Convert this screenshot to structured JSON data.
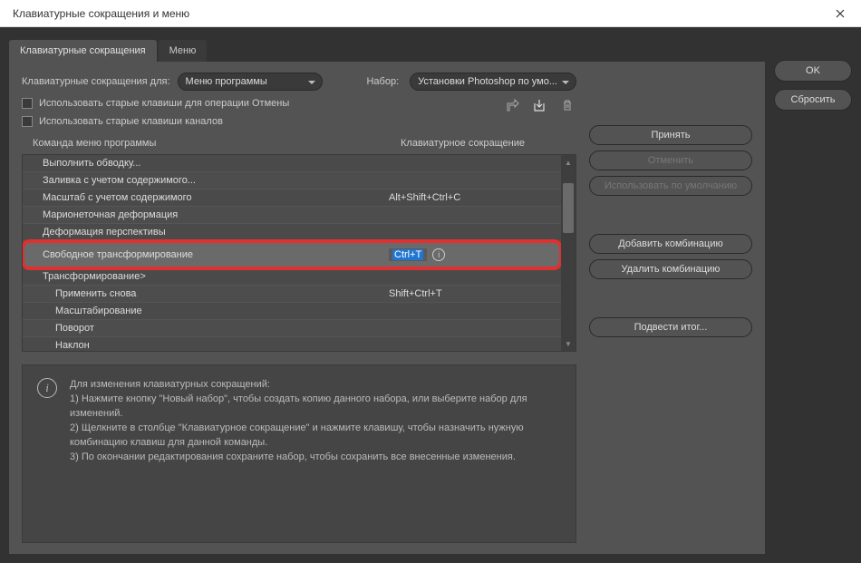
{
  "window": {
    "title": "Клавиатурные сокращения и меню"
  },
  "tabs": [
    {
      "label": "Клавиатурные сокращения",
      "active": true
    },
    {
      "label": "Меню",
      "active": false
    }
  ],
  "shortcutsFor": {
    "label": "Клавиатурные сокращения для:",
    "value": "Меню программы"
  },
  "set": {
    "label": "Набор:",
    "value": "Установки Photoshop по умо..."
  },
  "checkboxes": {
    "legacyUndo": "Использовать старые клавиши для операции Отмены",
    "legacyChannel": "Использовать старые клавиши каналов"
  },
  "columns": {
    "cmd": "Команда меню программы",
    "shortcut": "Клавиатурное сокращение"
  },
  "rows": [
    {
      "cmd": "Выполнить обводку...",
      "shortcut": "",
      "indent": false
    },
    {
      "cmd": "Заливка с учетом содержимого...",
      "shortcut": "",
      "indent": false
    },
    {
      "cmd": "Масштаб с учетом содержимого",
      "shortcut": "Alt+Shift+Ctrl+C",
      "indent": false
    },
    {
      "cmd": "Марионеточная деформация",
      "shortcut": "",
      "indent": false
    },
    {
      "cmd": "Деформация перспективы",
      "shortcut": "",
      "indent": false
    },
    {
      "cmd": "Свободное трансформирование",
      "shortcut": "Ctrl+T",
      "indent": false,
      "selected": true,
      "editing": true,
      "highlighted": true
    },
    {
      "cmd": "Трансформирование>",
      "shortcut": "",
      "indent": false
    },
    {
      "cmd": "Применить снова",
      "shortcut": "Shift+Ctrl+T",
      "indent": true
    },
    {
      "cmd": "Масштабирование",
      "shortcut": "",
      "indent": true
    },
    {
      "cmd": "Поворот",
      "shortcut": "",
      "indent": true
    },
    {
      "cmd": "Наклон",
      "shortcut": "",
      "indent": true
    }
  ],
  "sideButtons": {
    "accept": "Принять",
    "undo": "Отменить",
    "useDefault": "Использовать по умолчанию",
    "addCombo": "Добавить комбинацию",
    "deleteCombo": "Удалить комбинацию",
    "summarize": "Подвести итог..."
  },
  "dialogButtons": {
    "ok": "OK",
    "reset": "Сбросить"
  },
  "info": {
    "heading": "Для изменения клавиатурных сокращений:",
    "line1": "1) Нажмите кнопку \"Новый набор\", чтобы создать копию данного набора, или выберите набор для изменений.",
    "line2": "2) Щелкните в столбце \"Клавиатурное сокращение\" и нажмите клавишу, чтобы назначить нужную комбинацию клавиш для данной команды.",
    "line3": "3) По окончании редактирования сохраните набор, чтобы сохранить все внесенные изменения."
  }
}
